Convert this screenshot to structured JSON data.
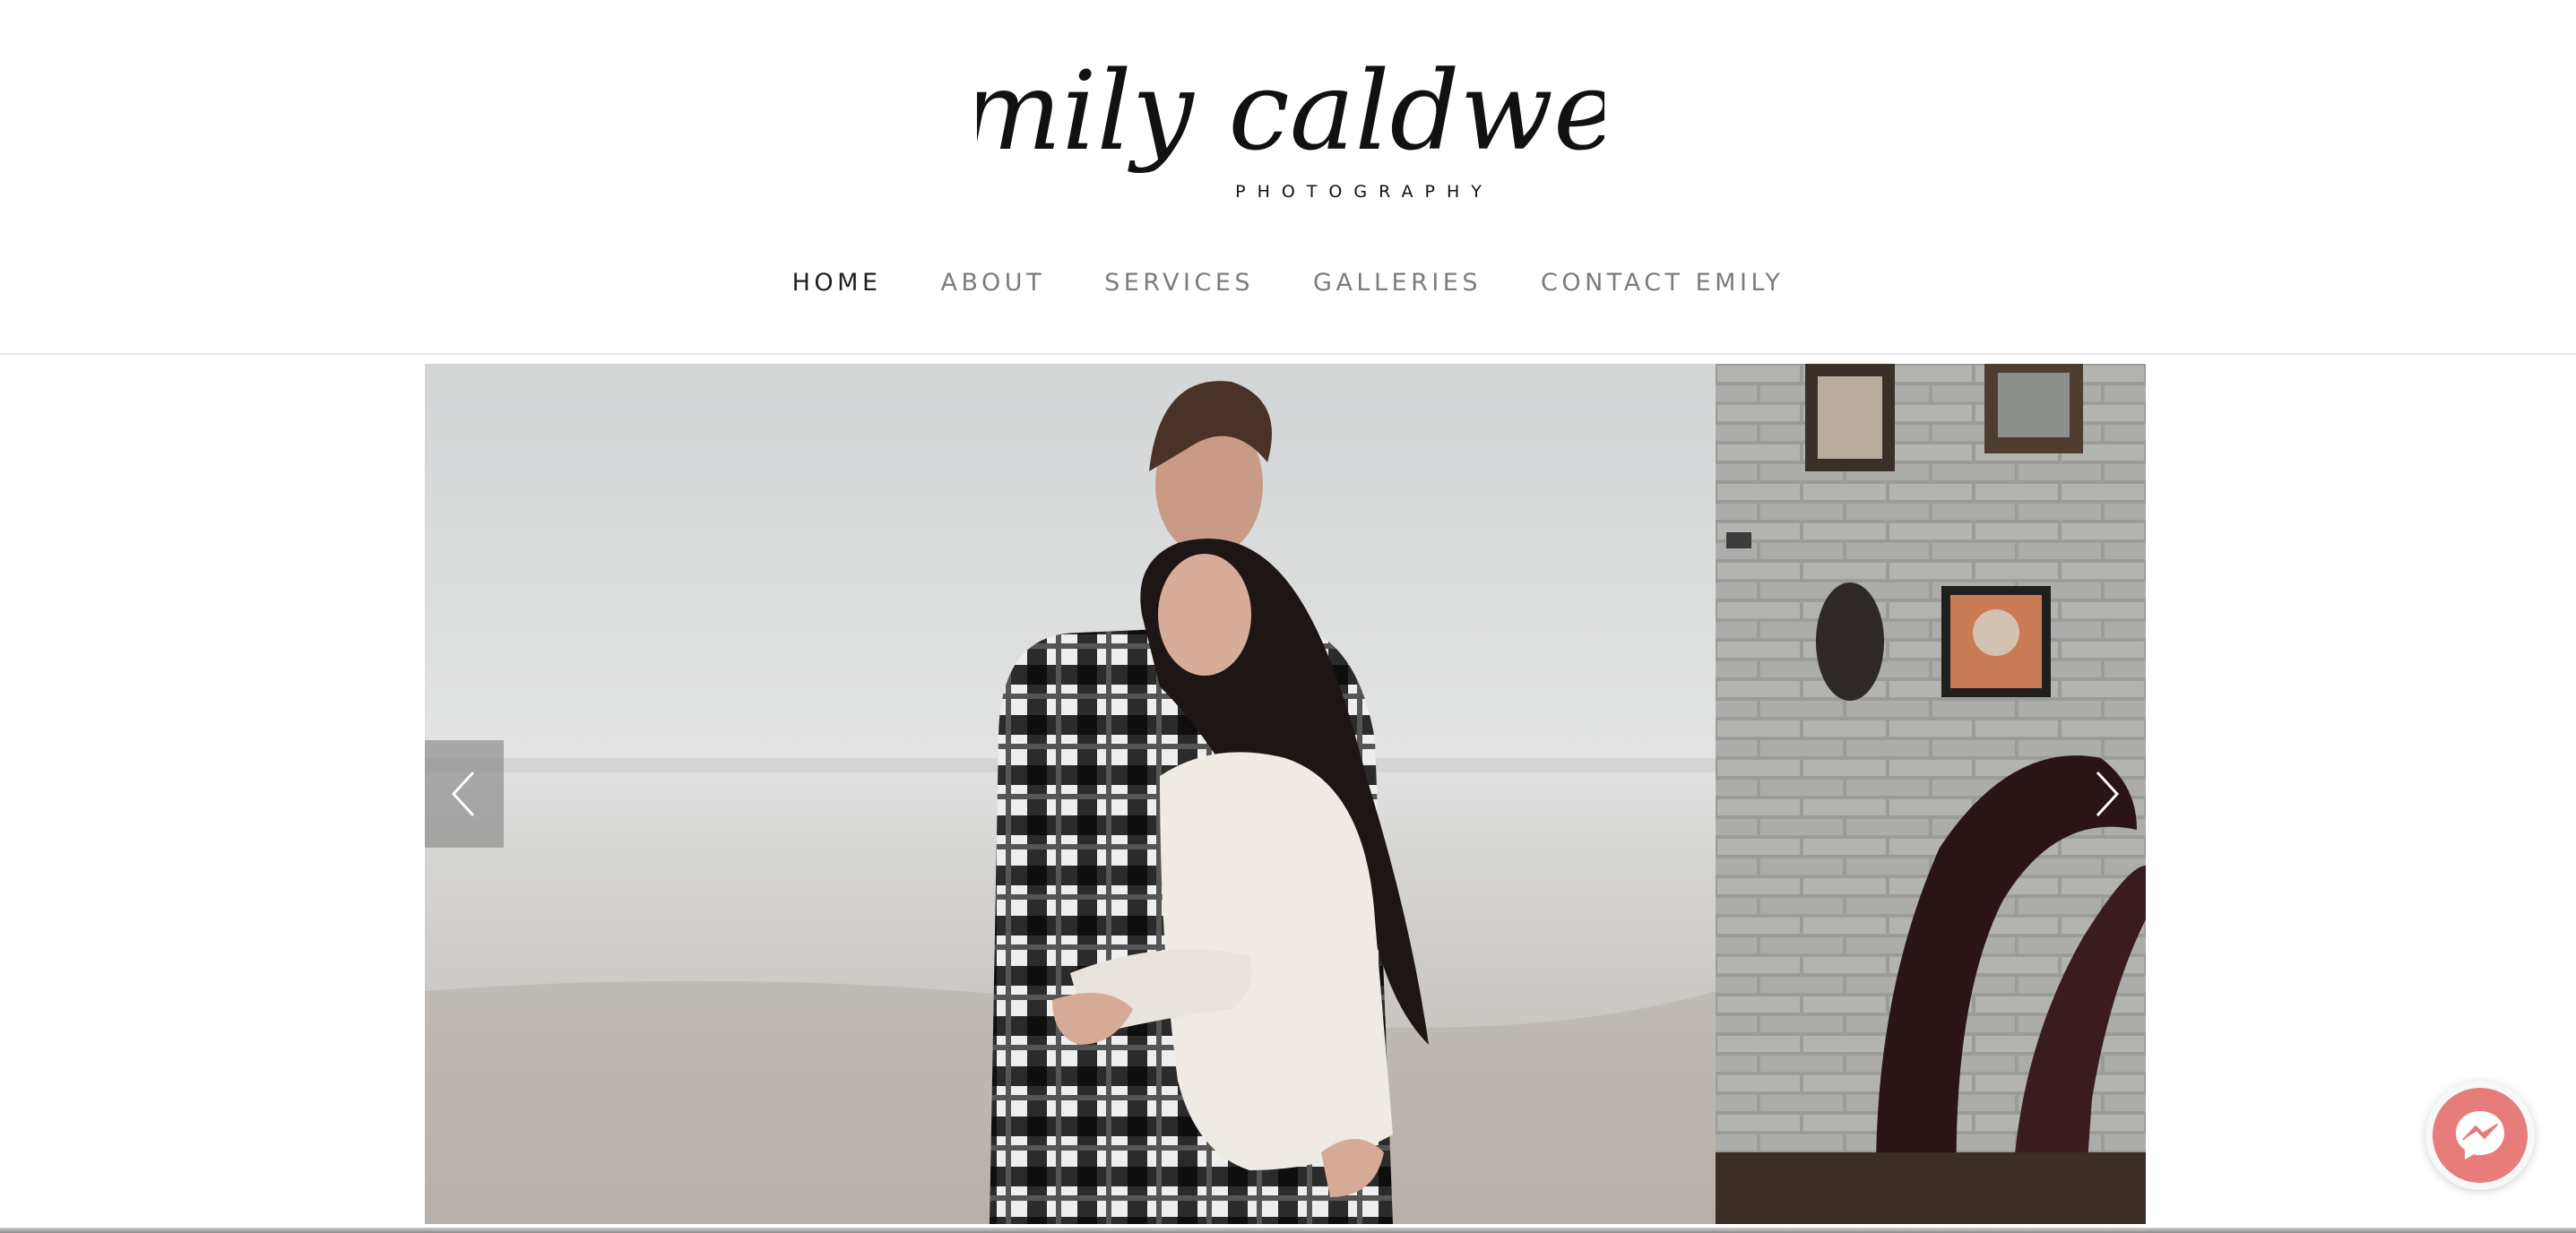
{
  "logo": {
    "script_text": "emily caldwell",
    "subtitle": "PHOTOGRAPHY"
  },
  "nav": {
    "items": [
      {
        "label": "HOME",
        "active": true
      },
      {
        "label": "ABOUT",
        "active": false
      },
      {
        "label": "SERVICES",
        "active": false
      },
      {
        "label": "GALLERIES",
        "active": false
      },
      {
        "label": "CONTACT EMILY",
        "active": false
      }
    ]
  },
  "slider": {
    "icons": {
      "prev": "chevron-left-icon",
      "next": "chevron-right-icon"
    }
  },
  "chat": {
    "icon": "messenger-icon",
    "color": "#e67d7a"
  },
  "colors": {
    "nav_active": "#1f1f1f",
    "nav_inactive": "#7c7c7c",
    "background": "#ffffff"
  }
}
